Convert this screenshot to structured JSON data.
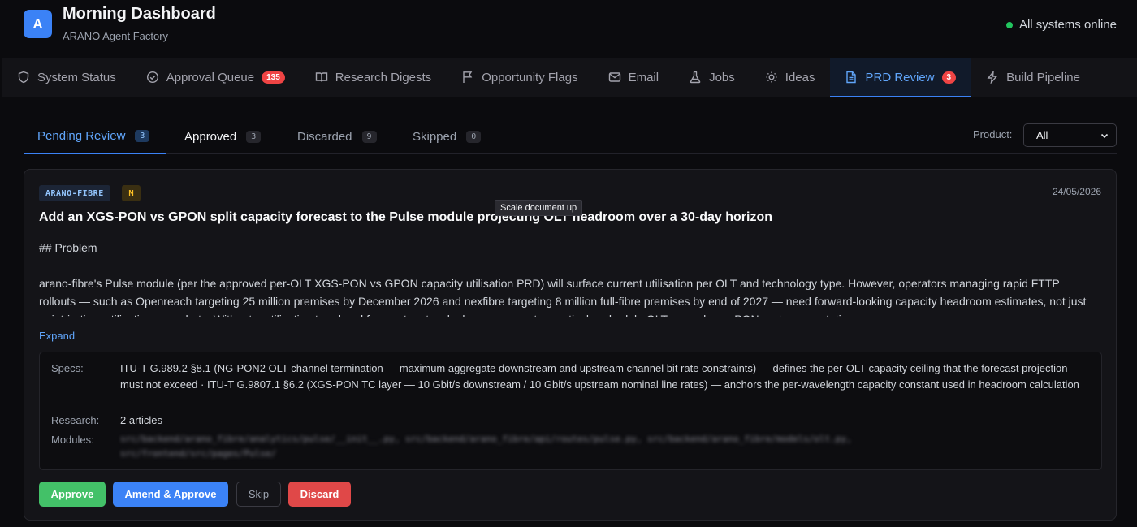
{
  "header": {
    "logo_letter": "A",
    "title": "Morning Dashboard",
    "subtitle": "ARANO Agent Factory",
    "status": "All systems online"
  },
  "nav": {
    "items": [
      {
        "label": "System Status",
        "icon": "shield-icon"
      },
      {
        "label": "Approval Queue",
        "icon": "check-circle-icon",
        "badge": "135"
      },
      {
        "label": "Research Digests",
        "icon": "book-icon"
      },
      {
        "label": "Opportunity Flags",
        "icon": "flag-icon"
      },
      {
        "label": "Email",
        "icon": "mail-icon"
      },
      {
        "label": "Jobs",
        "icon": "flask-icon"
      },
      {
        "label": "Ideas",
        "icon": "lightbulb-icon"
      },
      {
        "label": "PRD Review",
        "icon": "document-icon",
        "badge": "3",
        "active": true
      },
      {
        "label": "Build Pipeline",
        "icon": "lightning-icon"
      }
    ]
  },
  "subtabs": [
    {
      "label": "Pending Review",
      "count": "3"
    },
    {
      "label": "Approved",
      "count": "3"
    },
    {
      "label": "Discarded",
      "count": "9"
    },
    {
      "label": "Skipped",
      "count": "0"
    }
  ],
  "filter": {
    "label": "Product:",
    "value": "All"
  },
  "card": {
    "product_tag": "ARANO-FIBRE",
    "size_tag": "M",
    "date": "24/05/2026",
    "title": "Add an XGS-PON vs GPON split capacity forecast to the Pulse module projecting OLT headroom over a 30-day horizon",
    "tooltip": "Scale document up",
    "body_heading": "## Problem",
    "body_text": "arano-fibre's Pulse module (per the approved per-OLT XGS-PON vs GPON capacity utilisation PRD) will surface current utilisation per OLT and technology type. However, operators managing rapid FTTP rollouts — such as Openreach targeting 25 million premises by December 2026 and nexfibre targeting 8 million full-fibre premises by end of 2027 — need forward-looking capacity headroom estimates, not just point-in-time utilisation snapshots. Without a utilisation trend and forecast, network planners cannot proactively schedule OLT upgrades or PON port augmentation",
    "expand_label": "Expand",
    "meta": {
      "specs_label": "Specs:",
      "specs_value": "ITU-T G.989.2 §8.1 (NG-PON2 OLT channel termination — maximum aggregate downstream and upstream channel bit rate constraints) — defines the per-OLT capacity ceiling that the forecast projection must not exceed · ITU-T G.9807.1 §6.2 (XGS-PON TC layer — 10 Gbit/s downstream / 10 Gbit/s upstream nominal line rates) — anchors the per-wavelength capacity constant used in headroom calculation",
      "research_label": "Research:",
      "research_value": "2 articles",
      "modules_label": "Modules:",
      "modules_line1": "src/backend/arano_fibre/analytics/pulse/__init__.py, src/backend/arano_fibre/api/routes/pulse.py, src/backend/arano_fibre/models/olt.py,",
      "modules_line2": "src/frontend/src/pages/Pulse/"
    },
    "actions": {
      "approve": "Approve",
      "amend": "Amend & Approve",
      "skip": "Skip",
      "discard": "Discard"
    }
  },
  "colors": {
    "accent": "#3b82f6",
    "badge": "#ef4444",
    "approve": "#43c168",
    "discard": "#e04848",
    "online": "#22c55e"
  }
}
